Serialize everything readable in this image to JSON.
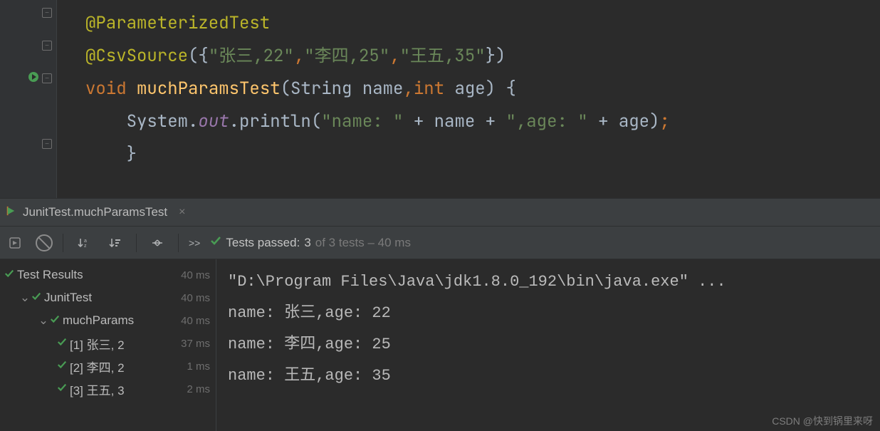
{
  "code": {
    "line1_annotation": "@ParameterizedTest",
    "line2_annotation": "@CsvSource",
    "line2_open": "({",
    "line2_arg1": "\"张三,22\"",
    "line2_sep1": ",",
    "line2_arg2": "\"李四,25\"",
    "line2_sep2": ",",
    "line2_arg3": "\"王五,35\"",
    "line2_close": "})",
    "line3_kw_void": "void",
    "line3_method": "muchParamsTest",
    "line3_open": "(",
    "line3_p1_type": "String",
    "line3_p1_name": " name",
    "line3_c1": ",",
    "line3_p2_type": "int",
    "line3_p2_name": " age",
    "line3_close": ") {",
    "line4_sys": "System",
    "line4_dot1": ".",
    "line4_out": "out",
    "line4_dot2": ".",
    "line4_println": "println",
    "line4_open": "(",
    "line4_s1": "\"name: \"",
    "line4_plus1": " + ",
    "line4_v1": "name",
    "line4_plus2": " + ",
    "line4_s2": "\",age: \"",
    "line4_plus3": " + ",
    "line4_v2": "age",
    "line4_close": ")",
    "line4_semi": ";",
    "line5_brace": "    }"
  },
  "tab": {
    "name": "JunitTest.muchParamsTest",
    "close": "×"
  },
  "toolbar": {
    "chevrons": ">>",
    "pass_prefix": "Tests passed:",
    "pass_count": " 3",
    "pass_suffix": " of 3 tests – 40 ms"
  },
  "tree": {
    "root": {
      "label": "Test Results",
      "ms": "40 ms"
    },
    "n1": {
      "label": "JunitTest",
      "ms": "40 ms"
    },
    "n2": {
      "label": "muchParams",
      "ms": "40 ms"
    },
    "leaf1": {
      "label": "[1] 张三, 2",
      "ms": "37 ms"
    },
    "leaf2": {
      "label": "[2] 李四, 2",
      "ms": "1 ms"
    },
    "leaf3": {
      "label": "[3] 王五, 3",
      "ms": "2 ms"
    }
  },
  "console": {
    "line1": "\"D:\\Program Files\\Java\\jdk1.8.0_192\\bin\\java.exe\" ...",
    "line2": "name: 张三,age: 22",
    "line3": "name: 李四,age: 25",
    "line4": "name: 王五,age: 35"
  },
  "watermark": "CSDN @快到锅里来呀"
}
